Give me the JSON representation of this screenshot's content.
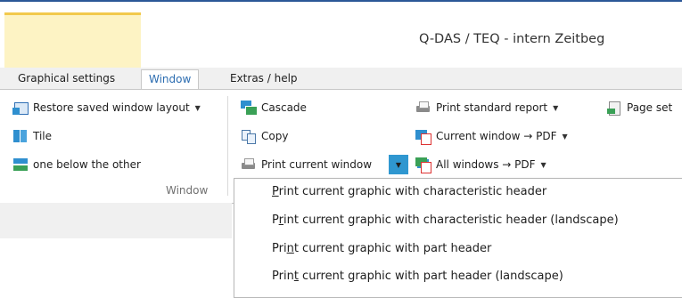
{
  "window": {
    "title": "Q-DAS / TEQ - intern Zeitbeg"
  },
  "tabs": [
    {
      "label": "Graphical settings",
      "active": false
    },
    {
      "label": "Window",
      "active": true
    },
    {
      "label": "Extras / help",
      "active": false
    }
  ],
  "ribbon": {
    "window_group": {
      "label": "Window",
      "restore_layout": "Restore saved window layout",
      "tile": "Tile",
      "below": "one below the other",
      "cascade": "Cascade",
      "copy": "Copy",
      "print_current_window": "Print current window"
    },
    "print_group": {
      "print_standard_report": "Print standard report",
      "page_setup": "Page set",
      "current_window_pdf": "Current window → PDF",
      "all_windows_pdf": "All windows → PDF"
    }
  },
  "dropdown_menu": {
    "items": [
      {
        "accel": "P",
        "rest": "rint current graphic with characteristic header"
      },
      {
        "pre": "P",
        "accel": "r",
        "rest": "int current graphic with characteristic header (landscape)"
      },
      {
        "pre": "Pri",
        "accel": "n",
        "rest": "t current graphic with part header"
      },
      {
        "pre": "Prin",
        "accel": "t",
        "rest": " current graphic with part header (landscape)"
      }
    ]
  },
  "colors": {
    "accent_blue": "#2b6cb0",
    "split_highlight": "#2f97d0",
    "quick_tile": "#fdf3c4"
  },
  "icons": [
    "restore-layout-icon",
    "tile-icon",
    "below-icon",
    "cascade-icon",
    "copy-icon",
    "printer-icon",
    "pdf-icon",
    "pdf-multi-icon",
    "page-setup-icon",
    "chevron-down-icon"
  ]
}
